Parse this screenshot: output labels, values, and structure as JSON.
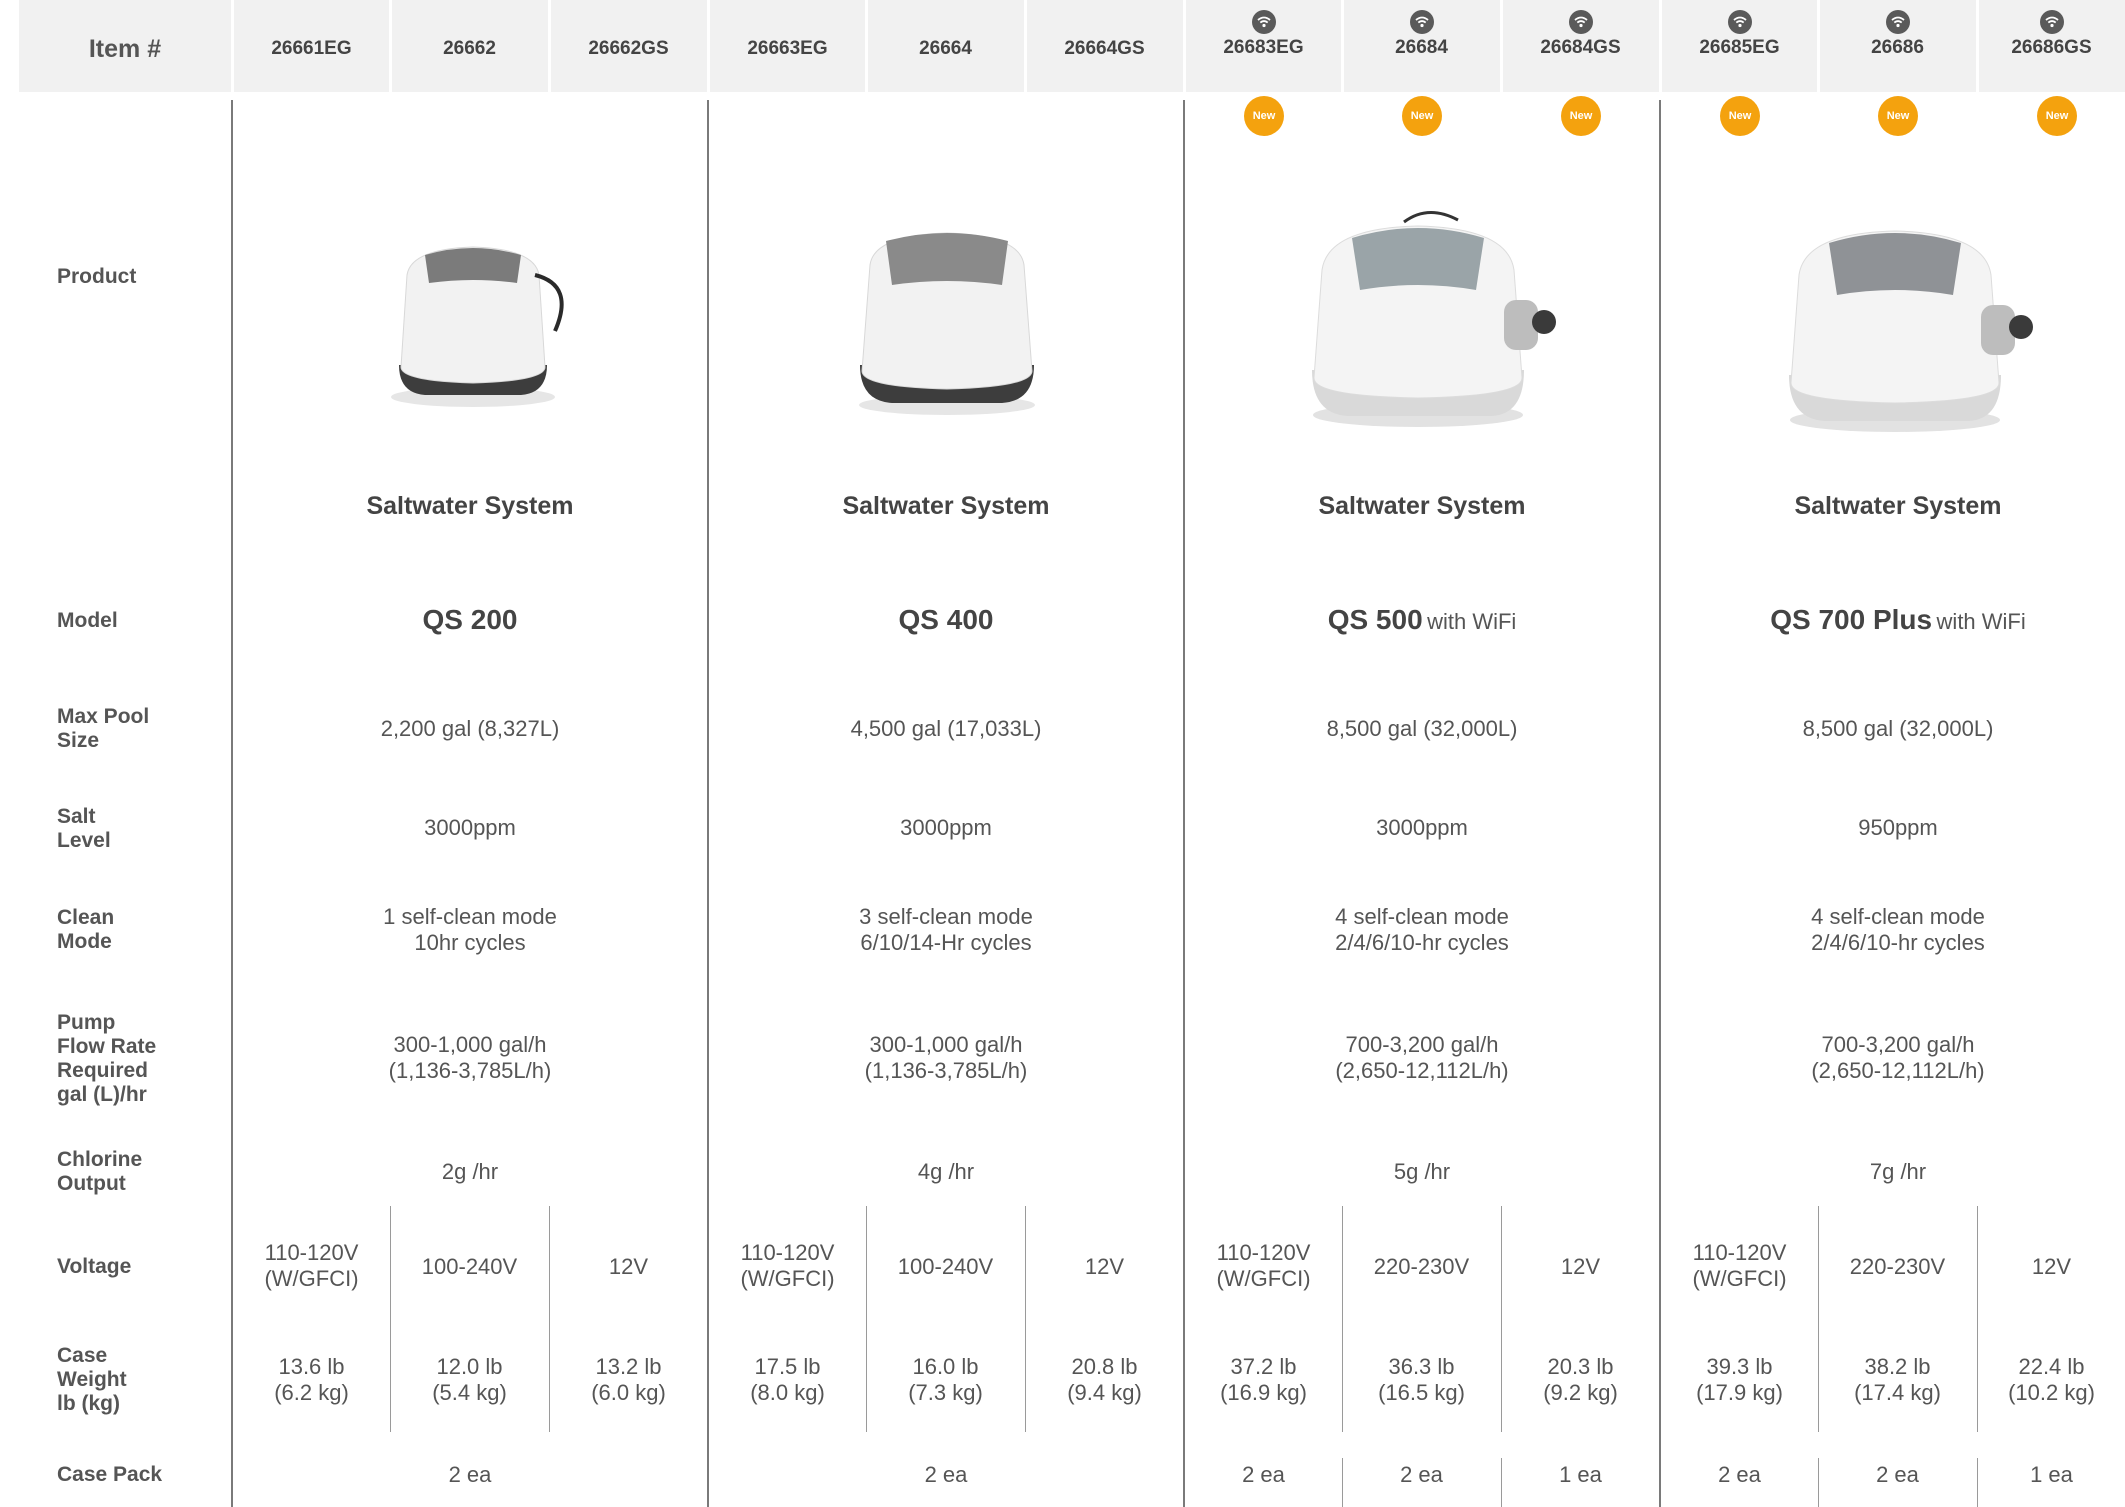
{
  "header": {
    "item_label": "Item #",
    "codes": [
      "26661EG",
      "26662",
      "26662GS",
      "26663EG",
      "26664",
      "26664GS",
      "26683EG",
      "26684",
      "26684GS",
      "26685EG",
      "26686",
      "26686GS"
    ],
    "wifi_icon": "wifi-icon"
  },
  "badge_label": "New",
  "row_labels": {
    "product": "Product",
    "model": "Model",
    "max_pool": [
      "Max Pool",
      "Size"
    ],
    "salt": [
      "Salt",
      "Level"
    ],
    "clean": [
      "Clean",
      "Mode"
    ],
    "pump": [
      "Pump",
      "Flow Rate",
      "Required",
      "gal (L)/hr"
    ],
    "chlorine": [
      "Chlorine",
      "Output"
    ],
    "voltage": "Voltage",
    "case_weight": [
      "Case",
      "Weight",
      "lb (kg)"
    ],
    "case_pack": "Case Pack"
  },
  "groups": [
    {
      "system": "Saltwater System",
      "model": "QS 200",
      "model_suffix": "",
      "max_pool": "2,200 gal (8,327L)",
      "salt": "3000ppm",
      "clean": [
        "1 self-clean mode",
        "10hr cycles"
      ],
      "pump": [
        "300-1,000 gal/h",
        "(1,136-3,785L/h)"
      ],
      "chlorine": "2g /hr",
      "case_pack": "2 ea",
      "colors": {
        "base": "#3d3d3d",
        "lid": "#7b7b7b"
      }
    },
    {
      "system": "Saltwater System",
      "model": "QS 400",
      "model_suffix": "",
      "max_pool": "4,500 gal (17,033L)",
      "salt": "3000ppm",
      "clean": [
        "3 self-clean mode",
        "6/10/14-Hr cycles"
      ],
      "pump": [
        "300-1,000 gal/h",
        "(1,136-3,785L/h)"
      ],
      "chlorine": "4g /hr",
      "case_pack": "2 ea",
      "colors": {
        "base": "#3d3d3d",
        "lid": "#8a8a8a"
      }
    },
    {
      "system": "Saltwater System",
      "model": "QS 500",
      "model_suffix": "with WiFi",
      "max_pool": "8,500 gal (32,000L)",
      "salt": "3000ppm",
      "clean": [
        "4 self-clean mode",
        "2/4/6/10-hr cycles"
      ],
      "pump": [
        "700-3,200 gal/h",
        "(2,650-12,112L/h)"
      ],
      "chlorine": "5g /hr",
      "colors": {
        "base": "#d9d9d9",
        "lid": "#9aa4a8"
      }
    },
    {
      "system": "Saltwater System",
      "model": "QS 700 Plus",
      "model_suffix": "with WiFi",
      "max_pool": "8,500 gal (32,000L)",
      "salt": "950ppm",
      "clean": [
        "4 self-clean mode",
        "2/4/6/10-hr cycles"
      ],
      "pump": [
        "700-3,200 gal/h",
        "(2,650-12,112L/h)"
      ],
      "chlorine": "7g /hr",
      "colors": {
        "base": "#d9d9d9",
        "lid": "#8f9296"
      }
    }
  ],
  "voltage": [
    [
      "110-120V",
      "(W/GFCI)"
    ],
    [
      "100-240V"
    ],
    [
      "12V"
    ],
    [
      "110-120V",
      "(W/GFCI)"
    ],
    [
      "100-240V"
    ],
    [
      "12V"
    ],
    [
      "110-120V",
      "(W/GFCI)"
    ],
    [
      "220-230V"
    ],
    [
      "12V"
    ],
    [
      "110-120V",
      "(W/GFCI)"
    ],
    [
      "220-230V"
    ],
    [
      "12V"
    ]
  ],
  "case_weight": [
    [
      "13.6 lb",
      "(6.2 kg)"
    ],
    [
      "12.0 lb",
      "(5.4 kg)"
    ],
    [
      "13.2 lb",
      "(6.0 kg)"
    ],
    [
      "17.5 lb",
      "(8.0 kg)"
    ],
    [
      "16.0 lb",
      "(7.3 kg)"
    ],
    [
      "20.8 lb",
      "(9.4 kg)"
    ],
    [
      "37.2 lb",
      "(16.9 kg)"
    ],
    [
      "36.3 lb",
      "(16.5 kg)"
    ],
    [
      "20.3 lb",
      "(9.2 kg)"
    ],
    [
      "39.3 lb",
      "(17.9 kg)"
    ],
    [
      "38.2 lb",
      "(17.4 kg)"
    ],
    [
      "22.4 lb",
      "(10.2 kg)"
    ]
  ],
  "case_pack_singles": [
    "2 ea",
    "2 ea",
    "1 ea",
    "2 ea",
    "2 ea",
    "1 ea"
  ],
  "accent_color": "#f4a20e"
}
